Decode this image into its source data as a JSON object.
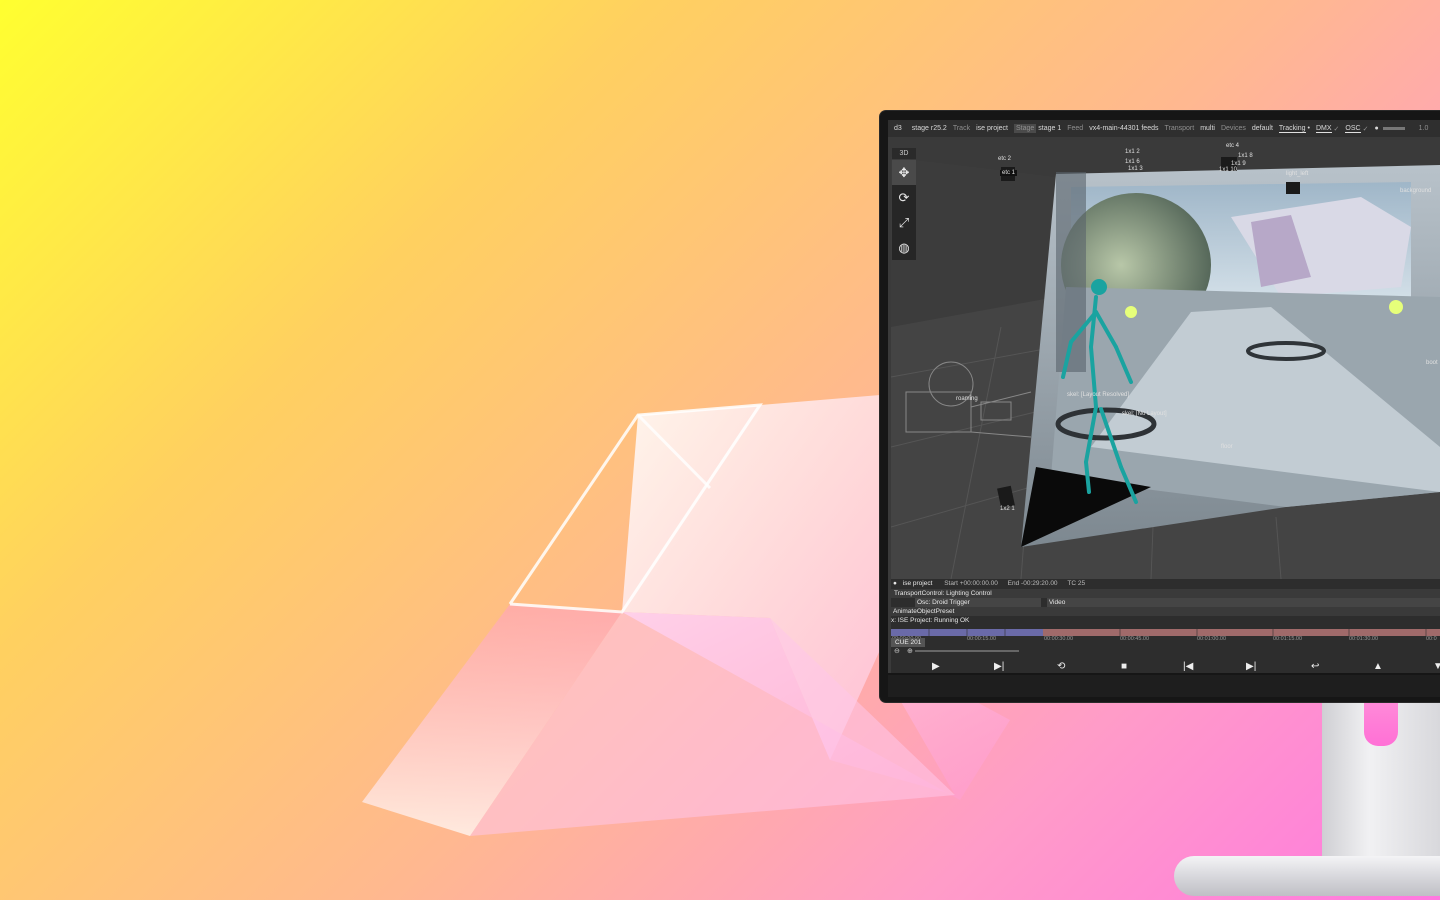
{
  "menubar": {
    "app": "d3",
    "version": "stage r25.2",
    "track_label": "Track",
    "track_value": "ise project",
    "stage_label": "Stage",
    "stage_value": "stage 1",
    "feed_label": "Feed",
    "feed_value": "vx4-main-44301 feeds",
    "transport_label": "Transport",
    "transport_value": "multi",
    "devices_label": "Devices",
    "devices_value": "default",
    "tracking": "Tracking",
    "dmx": "DMX",
    "osc": "OSC",
    "volume_value": "1.0"
  },
  "viewport": {
    "tab": "3D",
    "tools": [
      "move-icon",
      "rotate-icon",
      "scale-icon",
      "globe-icon"
    ],
    "labels": {
      "etc2": "etc 2",
      "etc1": "etc 1",
      "etc4": "etc 4",
      "l1x1_2": "1x1 2",
      "l1x1_6": "1x1 6",
      "l1x1_3": "1x1 3",
      "l1x1_8": "1x1 8",
      "l1x1_9": "1x1 9",
      "l1x1_10": "1x1 10",
      "light_left": "light_left",
      "background": "background",
      "roaming": "roaming",
      "skel1": "skel: [Layout Resolved]",
      "skel2": "skel: [No Layout]",
      "floor": "floor",
      "l1x2": "1x2 1",
      "boot": "boot"
    }
  },
  "bottom": {
    "project": "ise project",
    "start": "Start +00:00:00.00",
    "end": "End -00:29:20.00",
    "tc": "TC 25",
    "layers": [
      "TransportControl: Lighting Control",
      "Osc: Droid Trigger",
      "Video",
      "AnimateObjectPreset",
      "x: ISE Project: Running OK"
    ],
    "ticks": [
      "00:00:00.00",
      "00:00:15.00",
      "00:00:30.00",
      "00:00:45.00",
      "00:01:00.00",
      "00:01:15.00",
      "00:01:30.00",
      "00:0"
    ],
    "cue": "CUE 201"
  },
  "colors": {
    "accent_purple": "#6a6aa8",
    "accent_red": "#a06a6a",
    "teal_skeleton": "#1aa3a0"
  }
}
